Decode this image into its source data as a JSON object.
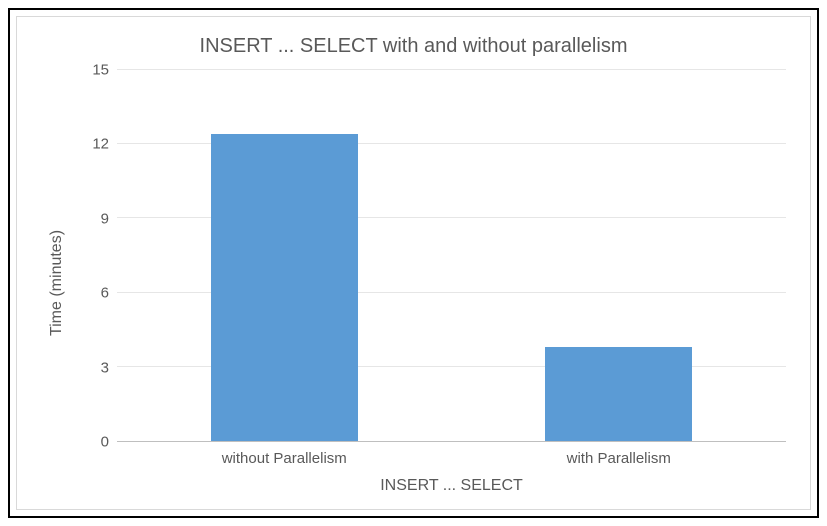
{
  "chart_data": {
    "type": "bar",
    "title": "INSERT ... SELECT with and without parallelism",
    "categories": [
      "without Parallelism",
      "with Parallelism"
    ],
    "values": [
      12.4,
      3.8
    ],
    "ylabel": "Time (minutes)",
    "xlabel": "INSERT ... SELECT",
    "ylim": [
      0,
      15
    ],
    "yticks": [
      0,
      3,
      6,
      9,
      12,
      15
    ],
    "bar_color": "#5b9bd5"
  }
}
